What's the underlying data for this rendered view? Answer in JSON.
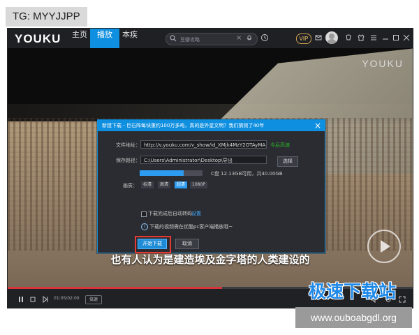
{
  "overlay": {
    "tg_label": "TG: MYYJJPP",
    "site_label": "www.ouboabgdl.org",
    "brand_overlay": "极速下载站"
  },
  "app": {
    "logo": "YOUKU",
    "nav": [
      "主页",
      "播放",
      "本疾"
    ],
    "active_nav_index": 1,
    "search_placeholder": "豆瓣攻略",
    "vip": "VIP",
    "watermark": "YOUKU"
  },
  "video": {
    "subtitle": "也有人认为是建造埃及金字塔的人类建设的",
    "time": "01:05/02:00",
    "speed": "倍速",
    "played_progress": 0.53
  },
  "dialog": {
    "title": "新建下载 - 巨石阵每块重约100万多吨，真的是外星文明？我们猜测了40年",
    "file_url_label": "文件地址：",
    "file_url": "http://v.youku.com/v_show/id_XMjk4MzY2OTAyMA==.html",
    "copy_link": "今后高速",
    "save_path_label": "保存路径：",
    "save_path": "C:\\Users\\Administrator\\Desktop\\导出",
    "choose_label": "选择",
    "disk_info": "C盘 12.13GB可用，共40.00GB",
    "disk_usage": 0.7,
    "quality_label": "画质：",
    "qualities": [
      "标清",
      "高清",
      "超清",
      "1080P"
    ],
    "selected_quality_index": 2,
    "auto_transcode_label": "下载完成后自动转码",
    "settings_label": "设置",
    "info_text": "下载的视频需在优酷pc客户端播放哦~",
    "start_label": "开始下载",
    "cancel_label": "取消"
  }
}
